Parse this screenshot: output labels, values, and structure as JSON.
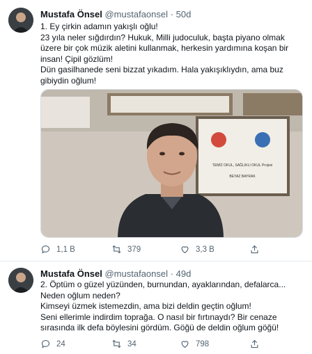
{
  "tweets": [
    {
      "author": "Mustafa Önsel",
      "handle": "@mustafaonsel",
      "separator": "·",
      "time": "50d",
      "lines": [
        "1. Ey çirkin adamın yakışlı oğlu!",
        "23 yıla neler sığdırdın? Hukuk, Milli judoculuk, başta piyano olmak üzere bir çok müzik aletini kullanmak, herkesin yardımına koşan bir insan! Çipil gözlüm!",
        "Dün gasilhanede seni bizzat yıkadım. Hala yakışıklıydın, ama buz gibiydin oğlum!"
      ],
      "photo_sign_lines": [
        "TEMİZ OKUL, SAĞLIKLI OKUL Projesi",
        "BEYAZ BAYRAK"
      ],
      "actions": {
        "replies": "1,1 B",
        "retweets": "379",
        "likes": "3,3 B"
      },
      "icons": [
        "reply-icon",
        "retweet-icon",
        "like-icon",
        "share-icon"
      ]
    },
    {
      "author": "Mustafa Önsel",
      "handle": "@mustafaonsel",
      "separator": "·",
      "time": "49d",
      "lines": [
        "2. Öptüm o güzel yüzünden, burnundan, ayaklarından, defalarca...",
        "Neden oğlum neden?",
        "Kimseyi üzmek istemezdin, ama bizi deldin geçtin oğlum!",
        "Seni ellerimle indirdim toprağa. O nasıl bir fırtınaydı? Bir cenaze sırasında ilk defa böylesini gördüm. Göğü de deldin oğlum göğü!"
      ],
      "actions": {
        "replies": "24",
        "retweets": "34",
        "likes": "798"
      },
      "icons": [
        "reply-icon",
        "retweet-icon",
        "like-icon",
        "share-icon"
      ]
    }
  ],
  "colors": {
    "text": "#0f1419",
    "secondary": "#536471",
    "divider": "#e6ecf0"
  }
}
